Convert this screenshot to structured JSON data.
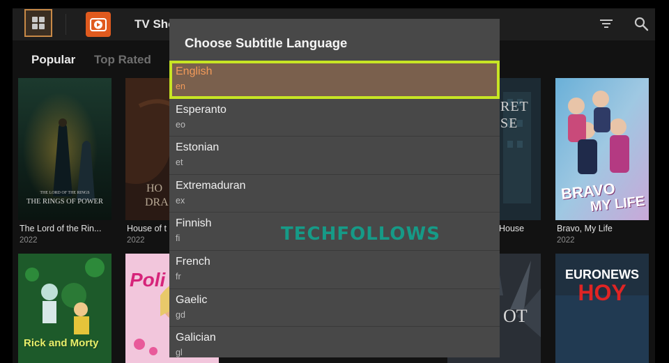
{
  "header": {
    "app_title": "TV Sho",
    "menu_icon": "grid-icon",
    "logo_icon": "play-logo-icon",
    "filter_icon": "filter-icon",
    "search_icon": "search-icon",
    "accent_color": "#c98a47"
  },
  "tabs": [
    {
      "label": "Popular",
      "active": true
    },
    {
      "label": "Top Rated",
      "active": false
    }
  ],
  "shows_row1": [
    {
      "title": "The Lord of the Rin...",
      "year": "2022",
      "poster_text_1": "THE LORD OF THE RINGS",
      "poster_text_2": "THE RINGS OF POWER"
    },
    {
      "title": "House of t",
      "year": "2022",
      "poster_text_1": "HO",
      "poster_text_2": "DRA"
    },
    {
      "title": "House",
      "year": "",
      "poster_text_1": "RET",
      "poster_text_2": "SE"
    },
    {
      "title": "Bravo, My Life",
      "year": "2022",
      "poster_text_1": "BRAVO",
      "poster_text_2": "MY LIFE"
    }
  ],
  "shows_row2": [
    {
      "poster_text_1": "Rick and Morty"
    },
    {
      "poster_text_1": "Poli"
    },
    {
      "poster_text_1": "OT"
    },
    {
      "poster_text_1": "EURONEWS",
      "poster_text_2": "HOY"
    }
  ],
  "watermark": "TECHFOLLOWS",
  "dialog": {
    "title": "Choose Subtitle Language",
    "selected_index": 0,
    "highlight_color": "#c8e524",
    "languages": [
      {
        "name": "English",
        "code": "en"
      },
      {
        "name": "Esperanto",
        "code": "eo"
      },
      {
        "name": "Estonian",
        "code": "et"
      },
      {
        "name": "Extremaduran",
        "code": "ex"
      },
      {
        "name": "Finnish",
        "code": "fi"
      },
      {
        "name": "French",
        "code": "fr"
      },
      {
        "name": "Gaelic",
        "code": "gd"
      },
      {
        "name": "Galician",
        "code": "gl"
      }
    ]
  }
}
